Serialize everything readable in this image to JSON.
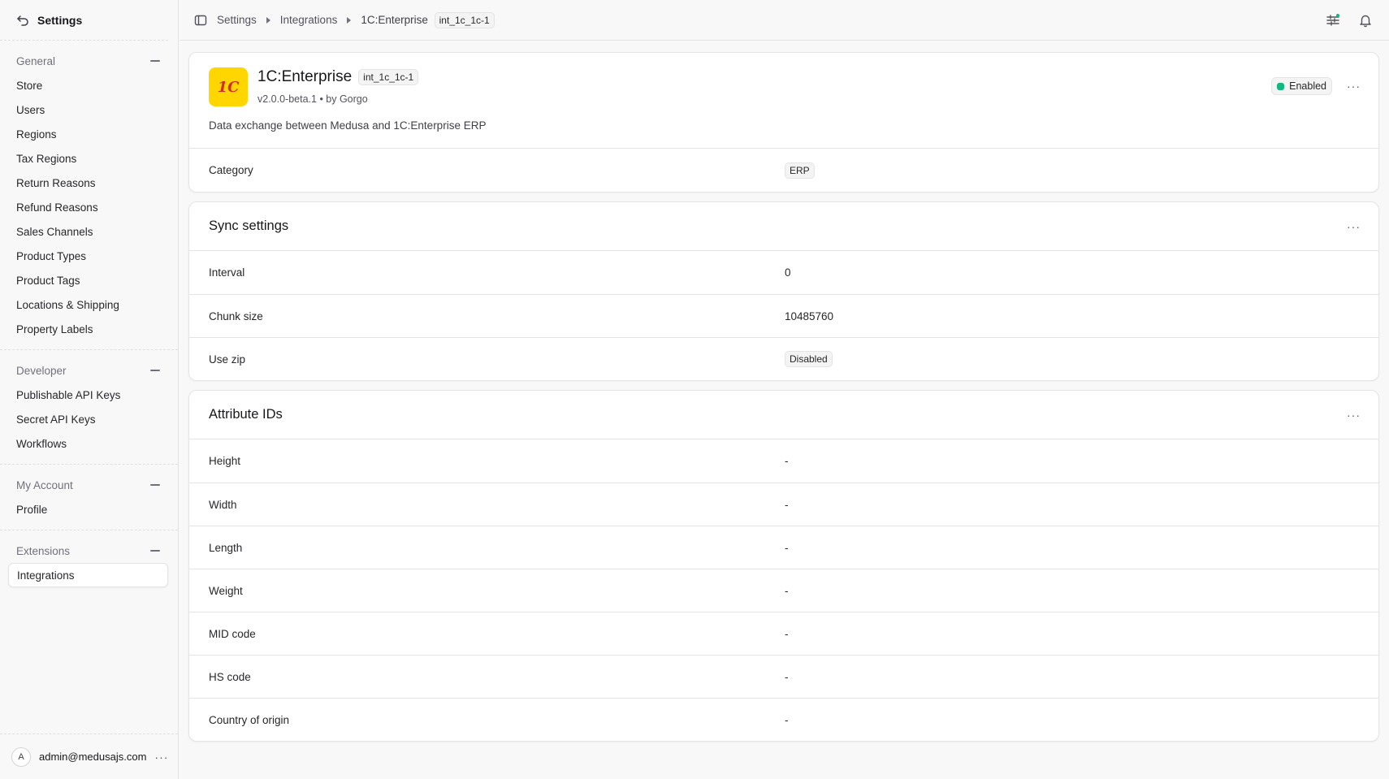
{
  "sidebar": {
    "title": "Settings",
    "sections": [
      {
        "heading": "General",
        "items": [
          "Store",
          "Users",
          "Regions",
          "Tax Regions",
          "Return Reasons",
          "Refund Reasons",
          "Sales Channels",
          "Product Types",
          "Product Tags",
          "Locations & Shipping",
          "Property Labels"
        ]
      },
      {
        "heading": "Developer",
        "items": [
          "Publishable API Keys",
          "Secret API Keys",
          "Workflows"
        ]
      },
      {
        "heading": "My Account",
        "items": [
          "Profile"
        ]
      },
      {
        "heading": "Extensions",
        "items": [
          "Integrations"
        ]
      }
    ],
    "user": {
      "initial": "A",
      "email": "admin@medusajs.com"
    }
  },
  "breadcrumb": {
    "items": [
      "Settings",
      "Integrations",
      "1C:Enterprise"
    ],
    "tag": "int_1c_1c-1"
  },
  "integration": {
    "logo_text": "1С",
    "name": "1C:Enterprise",
    "id_tag": "int_1c_1c-1",
    "version_line": "v2.0.0-beta.1 • by Gorgo",
    "description": "Data exchange between Medusa and 1C:Enterprise ERP",
    "status": "Enabled",
    "status_color": "#10b981",
    "category_label": "Category",
    "category_value": "ERP"
  },
  "sync": {
    "title": "Sync settings",
    "rows": [
      {
        "label": "Interval",
        "value": "0"
      },
      {
        "label": "Chunk size",
        "value": "10485760"
      },
      {
        "label": "Use zip",
        "value": "Disabled"
      }
    ]
  },
  "attributes": {
    "title": "Attribute IDs",
    "rows": [
      {
        "label": "Height",
        "value": "-"
      },
      {
        "label": "Width",
        "value": "-"
      },
      {
        "label": "Length",
        "value": "-"
      },
      {
        "label": "Weight",
        "value": "-"
      },
      {
        "label": "MID code",
        "value": "-"
      },
      {
        "label": "HS code",
        "value": "-"
      },
      {
        "label": "Country of origin",
        "value": "-"
      }
    ]
  },
  "icons": {
    "more": "···"
  }
}
